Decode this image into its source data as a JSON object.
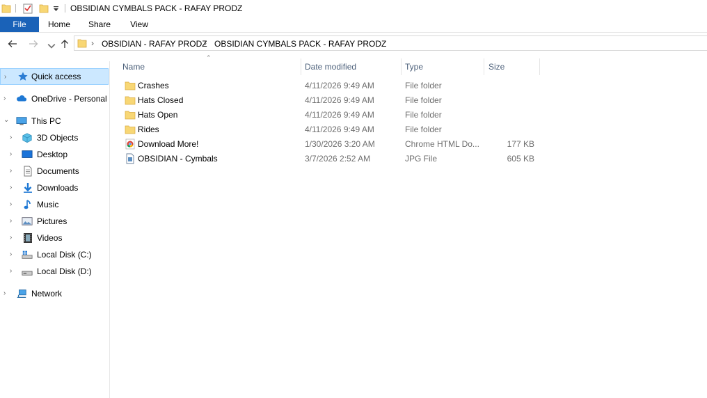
{
  "window": {
    "title": "OBSIDIAN CYMBALS PACK - RAFAY PRODZ"
  },
  "ribbon": {
    "tabs": [
      "File",
      "Home",
      "Share",
      "View"
    ]
  },
  "address": {
    "crumbs": [
      "OBSIDIAN - RAFAY PRODZ",
      "OBSIDIAN CYMBALS PACK - RAFAY PRODZ"
    ]
  },
  "sidebar": {
    "items": [
      {
        "label": "Quick access",
        "icon": "star-icon"
      },
      {
        "label": "OneDrive - Personal",
        "icon": "cloud-icon"
      },
      {
        "label": "This PC",
        "icon": "computer-icon"
      },
      {
        "label": "3D Objects",
        "icon": "cube-icon"
      },
      {
        "label": "Desktop",
        "icon": "desktop-icon"
      },
      {
        "label": "Documents",
        "icon": "document-icon"
      },
      {
        "label": "Downloads",
        "icon": "download-arrow-icon"
      },
      {
        "label": "Music",
        "icon": "music-note-icon"
      },
      {
        "label": "Pictures",
        "icon": "picture-icon"
      },
      {
        "label": "Videos",
        "icon": "film-icon"
      },
      {
        "label": "Local Disk (C:)",
        "icon": "windows-disk-icon"
      },
      {
        "label": "Local Disk (D:)",
        "icon": "disk-icon"
      },
      {
        "label": "Network",
        "icon": "network-icon"
      }
    ]
  },
  "columns": {
    "name": "Name",
    "date": "Date modified",
    "type": "Type",
    "size": "Size"
  },
  "files": [
    {
      "name": "Crashes",
      "date": "4/11/2026 9:49 AM",
      "type": "File folder",
      "size": "",
      "icon": "folder-icon"
    },
    {
      "name": "Hats Closed",
      "date": "4/11/2026 9:49 AM",
      "type": "File folder",
      "size": "",
      "icon": "folder-icon"
    },
    {
      "name": "Hats Open",
      "date": "4/11/2026 9:49 AM",
      "type": "File folder",
      "size": "",
      "icon": "folder-icon"
    },
    {
      "name": "Rides",
      "date": "4/11/2026 9:49 AM",
      "type": "File folder",
      "size": "",
      "icon": "folder-icon"
    },
    {
      "name": "Download More!",
      "date": "1/30/2026 3:20 AM",
      "type": "Chrome HTML Do...",
      "size": "177 KB",
      "icon": "chrome-icon"
    },
    {
      "name": "OBSIDIAN - Cymbals",
      "date": "3/7/2026 2:52 AM",
      "type": "JPG File",
      "size": "605 KB",
      "icon": "image-file-icon"
    }
  ],
  "colors": {
    "accent": "#1a62b8",
    "selection": "#cce8ff",
    "folder": "#f8d775"
  }
}
